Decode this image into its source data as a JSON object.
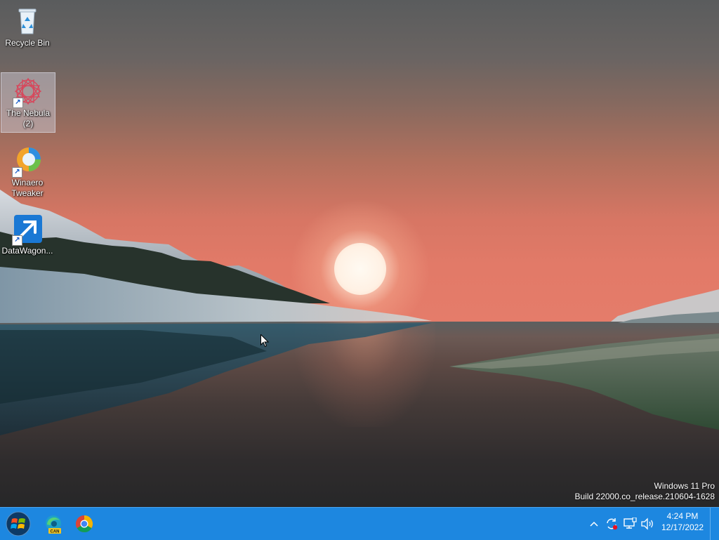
{
  "desktop": {
    "icons": [
      {
        "label": "Recycle Bin",
        "icon": "recycle-bin-icon",
        "selected": false
      },
      {
        "label": "The Nebula\n(2)",
        "line1": "The Nebula",
        "line2": "(2)",
        "icon": "nebula-app-icon",
        "selected": true
      },
      {
        "label": "Winaero Tweaker",
        "line1": "Winaero",
        "line2": "Tweaker",
        "icon": "winaero-tweaker-icon",
        "selected": false
      },
      {
        "label": "DataWagon...",
        "icon": "datawagon-icon",
        "selected": false
      }
    ]
  },
  "watermark": {
    "line1": "Windows 11 Pro",
    "line2": "Build 22000.co_release.210604-1628"
  },
  "taskbar": {
    "color": "#1d87e0",
    "pinned": [
      {
        "name": "start",
        "icon": "windows-logo-icon"
      },
      {
        "name": "edge-canary",
        "icon": "edge-canary-icon",
        "badge": "CAN"
      },
      {
        "name": "chrome",
        "icon": "chrome-icon"
      }
    ],
    "tray": {
      "icons": [
        "chevron-up-icon",
        "sync-icon",
        "network-icon",
        "volume-icon"
      ],
      "time": "4:24 PM",
      "date": "12/17/2022"
    }
  }
}
